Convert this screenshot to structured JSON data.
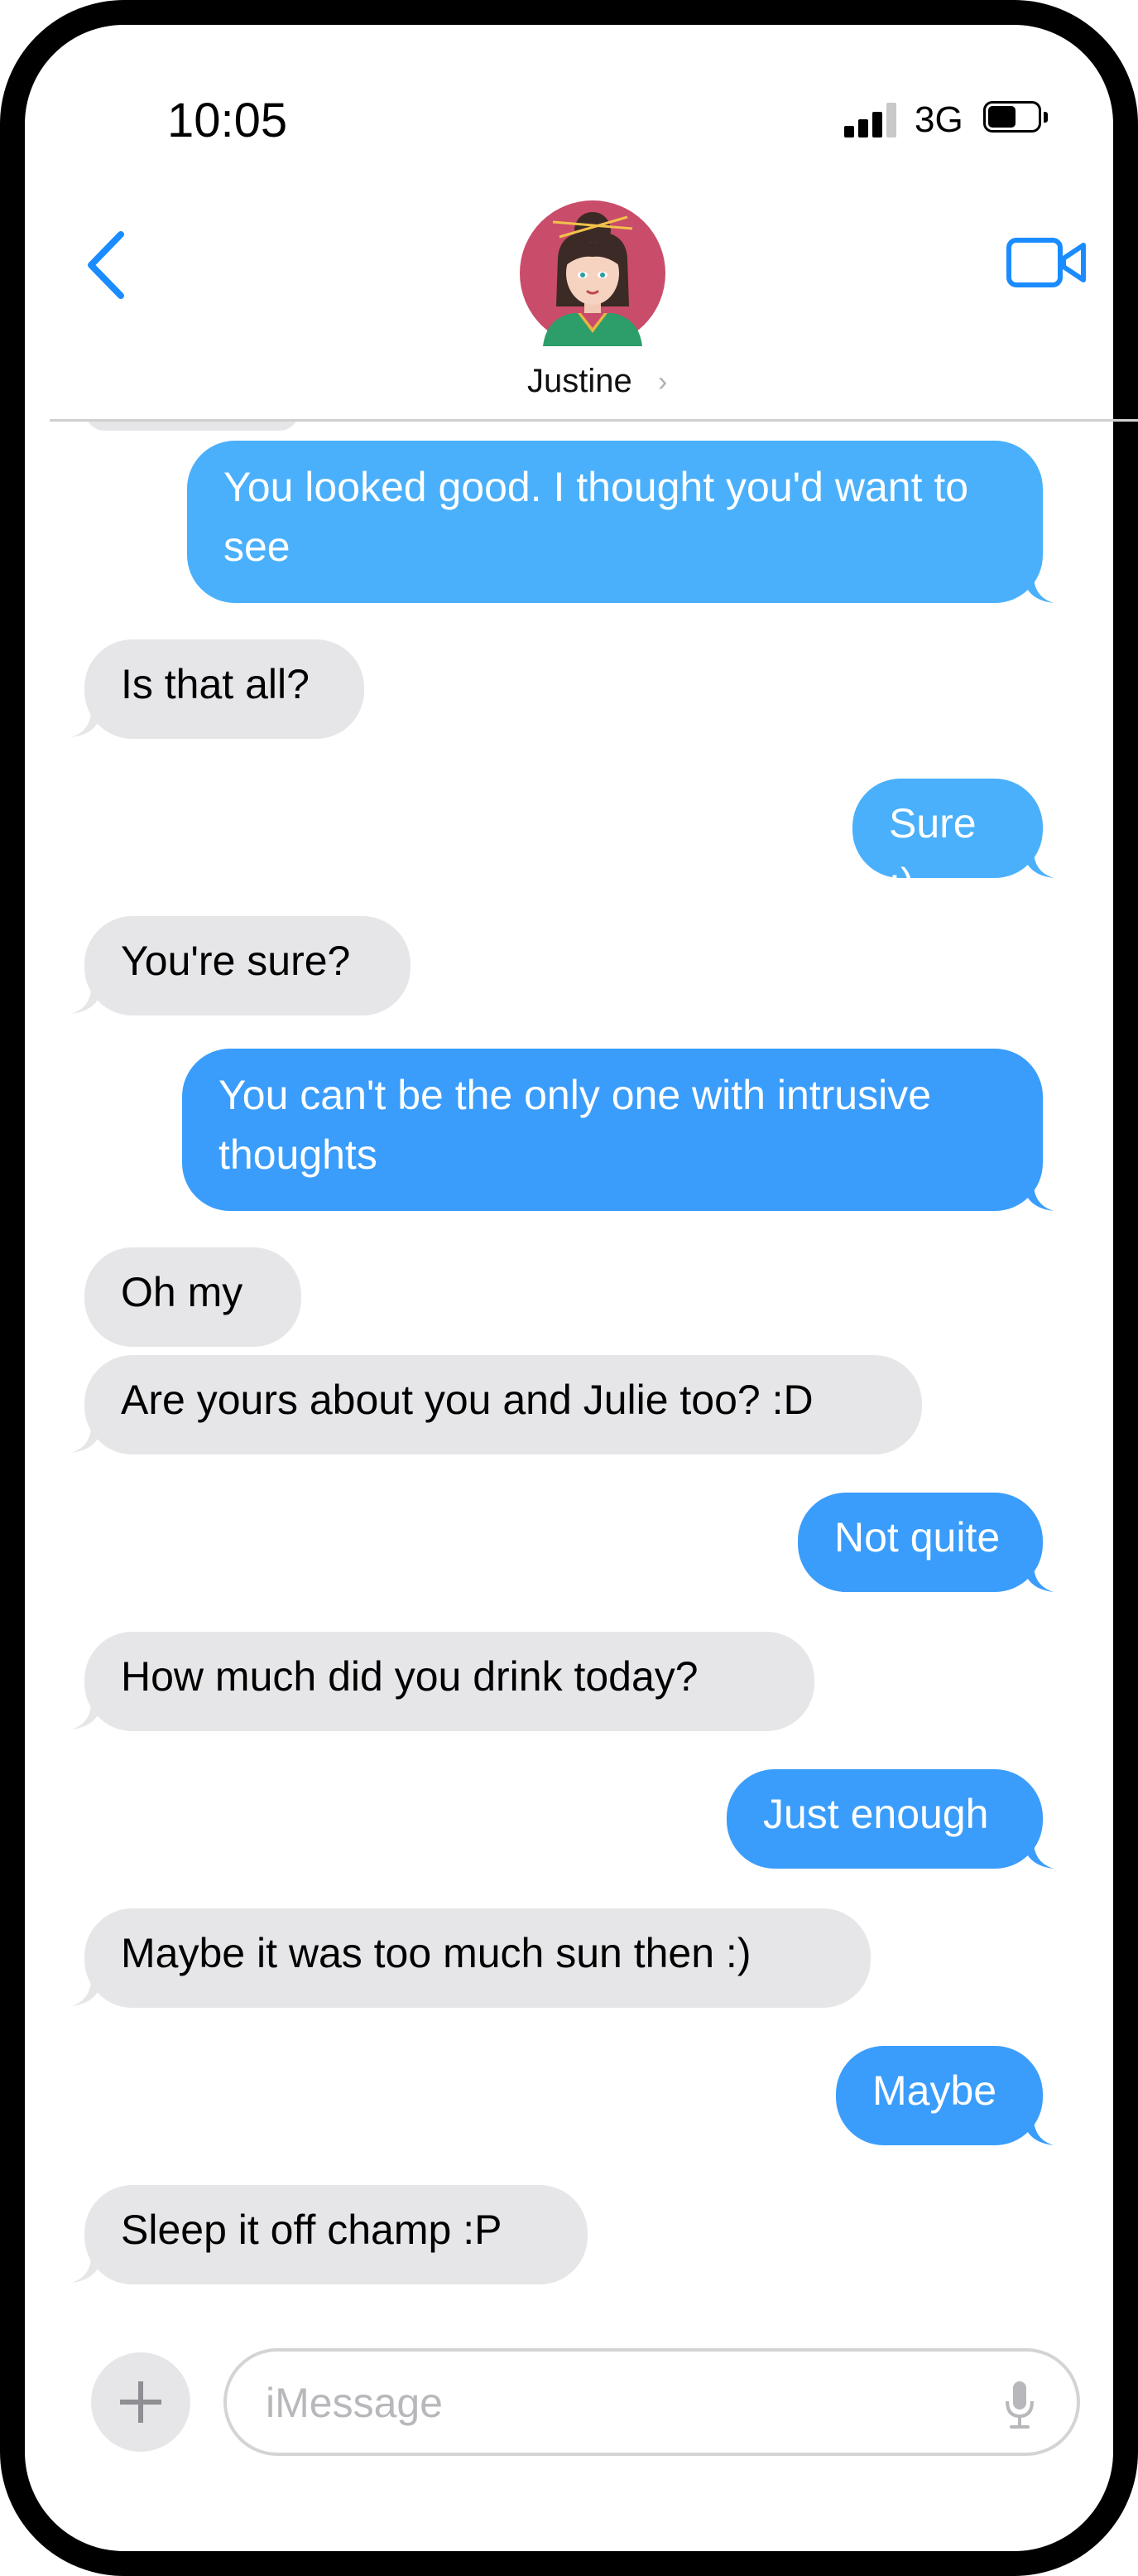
{
  "status_bar": {
    "time": "10:05",
    "network": "3G"
  },
  "header": {
    "contact_name": "Justine",
    "chevron": "›"
  },
  "messages": [
    {
      "from": "me",
      "text": "You looked good.  I thought you'd want to see"
    },
    {
      "from": "them",
      "text": "Is that all?"
    },
    {
      "from": "me",
      "text": "Sure :)"
    },
    {
      "from": "them",
      "text": "You're sure?"
    },
    {
      "from": "me",
      "text": "You can't be the only one with intrusive thoughts"
    },
    {
      "from": "them",
      "text": "Oh my"
    },
    {
      "from": "them",
      "text": "Are yours about you and Julie too? :D"
    },
    {
      "from": "me",
      "text": "Not quite"
    },
    {
      "from": "them",
      "text": "How much did you drink today?"
    },
    {
      "from": "me",
      "text": "Just enough"
    },
    {
      "from": "them",
      "text": "Maybe it was too much sun then :)"
    },
    {
      "from": "me",
      "text": "Maybe"
    },
    {
      "from": "them",
      "text": "Sleep it off champ :P"
    }
  ],
  "input": {
    "placeholder": "iMessage",
    "value": ""
  },
  "icons": {
    "back": "chevron-left-icon",
    "video": "video-camera-icon",
    "add": "plus-icon",
    "mic": "microphone-icon"
  },
  "colors": {
    "accent": "#1a8cff",
    "outgoing": "#3a9dfb",
    "incoming": "#e6e6e8"
  }
}
